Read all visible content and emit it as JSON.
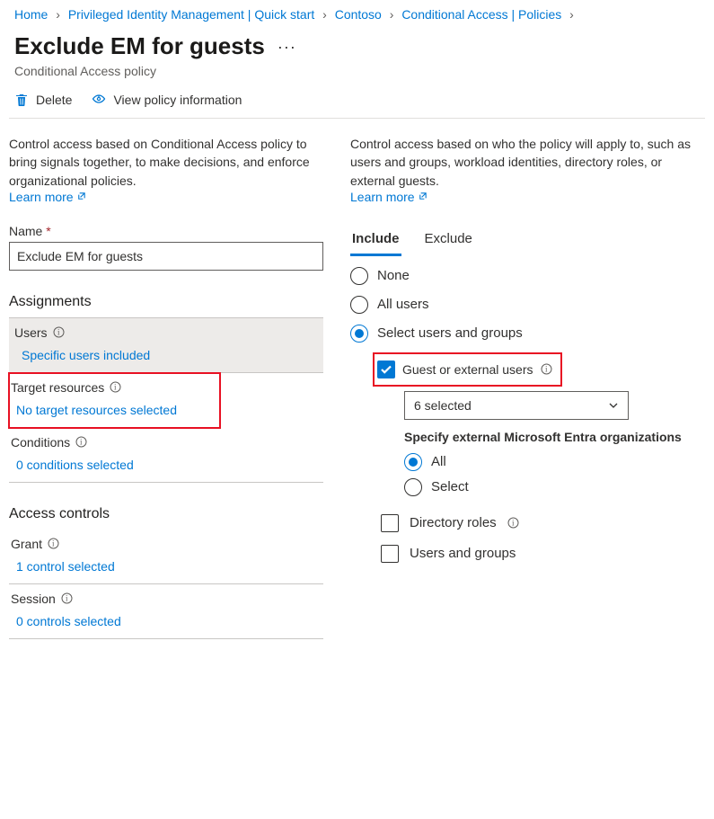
{
  "breadcrumb": [
    "Home",
    "Privileged Identity Management | Quick start",
    "Contoso",
    "Conditional Access | Policies"
  ],
  "header": {
    "title": "Exclude EM for guests",
    "subtitle": "Conditional Access policy"
  },
  "toolbar": {
    "delete": "Delete",
    "view_policy": "View policy information"
  },
  "left": {
    "intro": "Control access based on Conditional Access policy to bring signals together, to make decisions, and enforce organizational policies.",
    "learn_more": "Learn more",
    "name_label": "Name",
    "name_value": "Exclude EM for guests",
    "assignments_heading": "Assignments",
    "users": {
      "label": "Users",
      "value": "Specific users included"
    },
    "target": {
      "label": "Target resources",
      "value": "No target resources selected"
    },
    "conditions": {
      "label": "Conditions",
      "value": "0 conditions selected"
    },
    "access_heading": "Access controls",
    "grant": {
      "label": "Grant",
      "value": "1 control selected"
    },
    "session": {
      "label": "Session",
      "value": "0 controls selected"
    }
  },
  "right": {
    "intro": "Control access based on who the policy will apply to, such as users and groups, workload identities, directory roles, or external guests.",
    "learn_more": "Learn more",
    "tabs": {
      "include": "Include",
      "exclude": "Exclude"
    },
    "radios": {
      "none": "None",
      "all": "All users",
      "select": "Select users and groups"
    },
    "guest_checkbox": "Guest or external users",
    "guest_dropdown": "6 selected",
    "spec_label": "Specify external Microsoft Entra organizations",
    "org": {
      "all": "All",
      "select": "Select"
    },
    "dir_roles": "Directory roles",
    "users_groups": "Users and groups"
  }
}
